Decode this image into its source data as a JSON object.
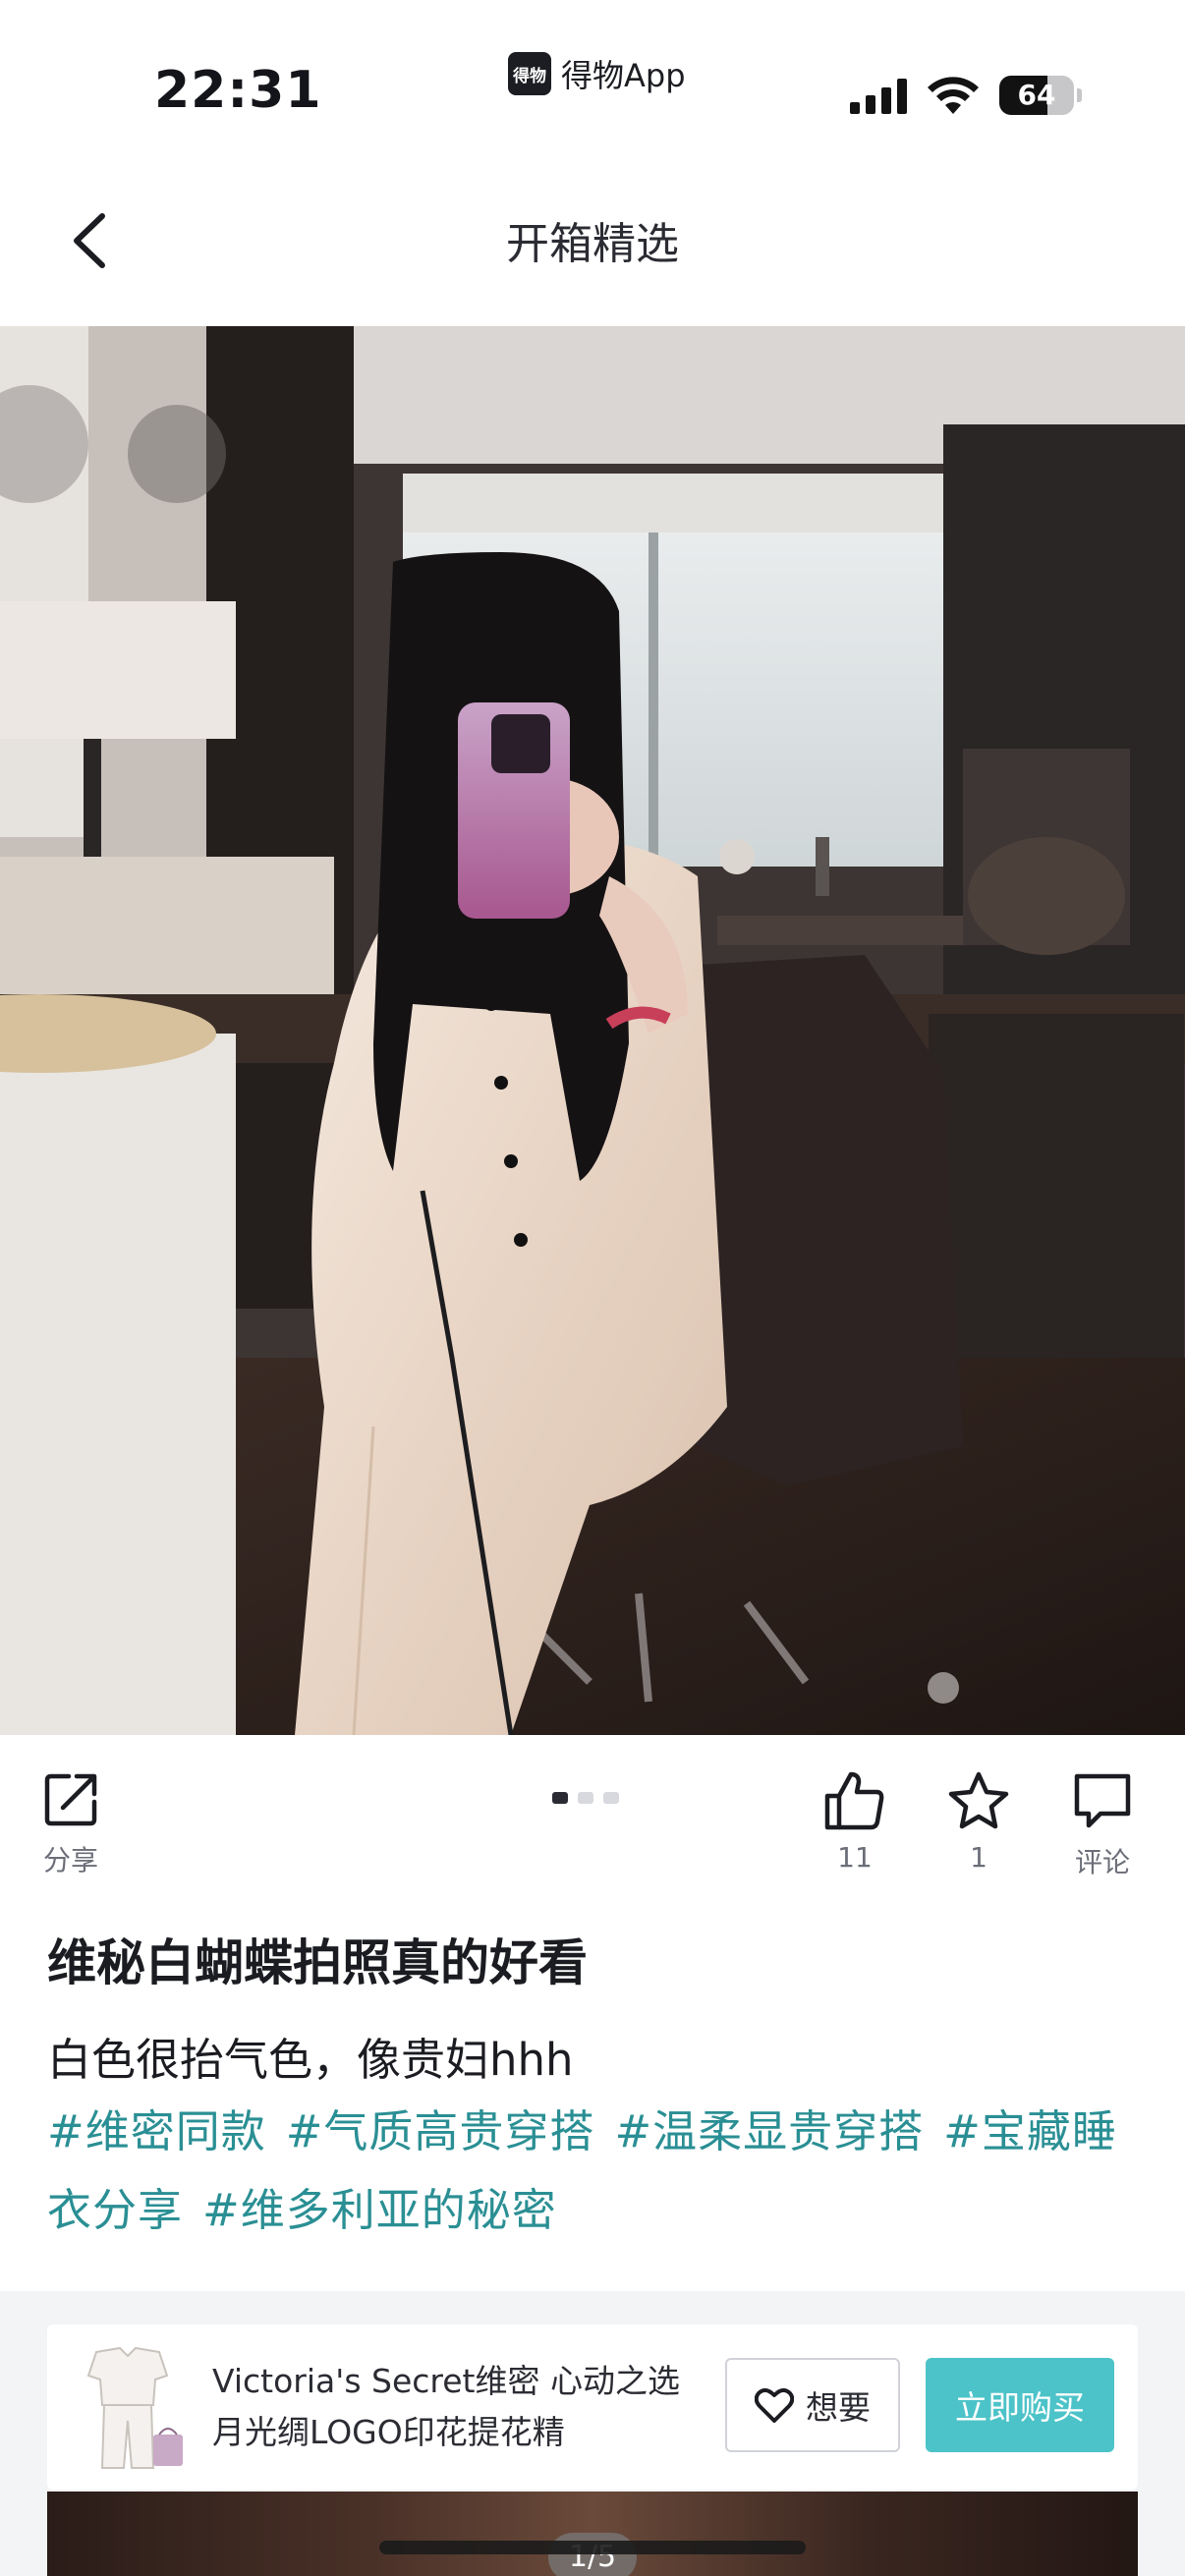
{
  "status_bar": {
    "time": "22:31",
    "app_logo_text": "得物",
    "app_name": "得物App",
    "battery": "64",
    "battery_level": 0.64
  },
  "nav": {
    "title": "开箱精选",
    "back_icon": "chevron-left-icon"
  },
  "photo": {
    "pager_total": 3,
    "pager_active": 0
  },
  "actions": {
    "share_label": "分享",
    "like_count": "11",
    "favorite_count": "1",
    "comment_label": "评论"
  },
  "post": {
    "title": "维秘白蝴蝶拍照真的好看",
    "body": "白色很抬气色，像贵妇hhh",
    "tags": [
      "#维密同款",
      "#气质高贵穿搭",
      "#温柔显贵穿搭",
      "#宝藏睡衣分享",
      "#维多利亚的秘密"
    ]
  },
  "product": {
    "name": "Victoria's Secret维密 心动之选 月光绸LOGO印花提花精",
    "want_label": "想要",
    "buy_label": "立即购买"
  },
  "next": {
    "counter": "1/5"
  },
  "colors": {
    "accent": "#4cc3c8",
    "tag": "#2a8f94"
  }
}
